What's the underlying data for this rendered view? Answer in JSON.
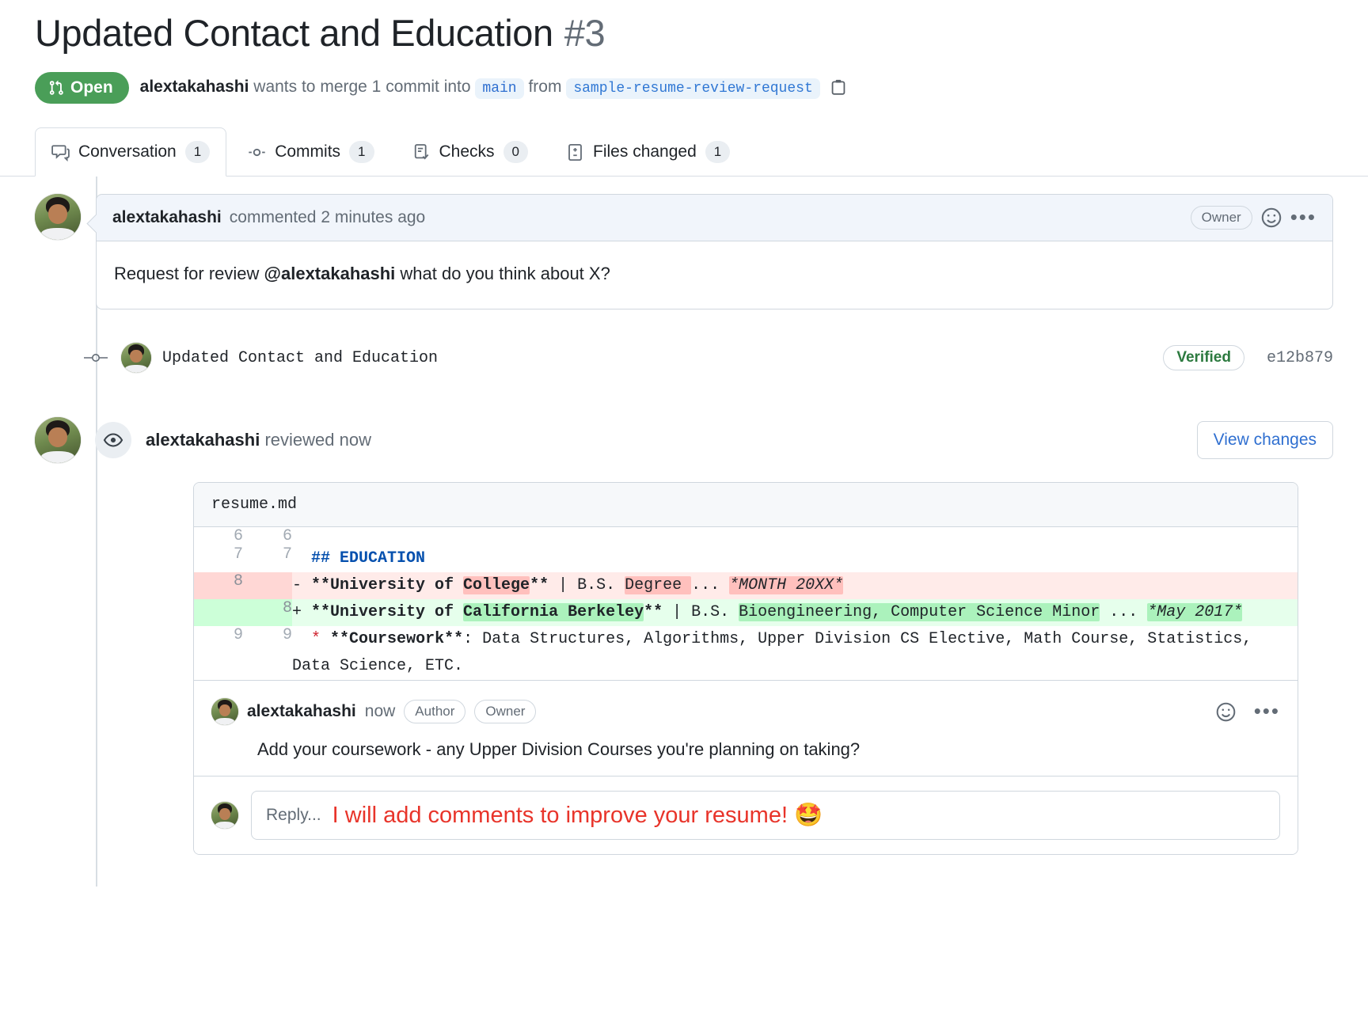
{
  "header": {
    "title": "Updated Contact and Education",
    "number": "#3",
    "state": "Open",
    "author": "alextakahashi",
    "merge_text_1": "wants to merge 1 commit into",
    "base_branch": "main",
    "from_word": "from",
    "head_branch": "sample-resume-review-request",
    "copy_icon": "copy-icon"
  },
  "tabs": [
    {
      "label": "Conversation",
      "count": "1",
      "icon": "comment-discussion-icon",
      "active": true
    },
    {
      "label": "Commits",
      "count": "1",
      "icon": "git-commit-icon",
      "active": false
    },
    {
      "label": "Checks",
      "count": "0",
      "icon": "checklist-icon",
      "active": false
    },
    {
      "label": "Files changed",
      "count": "1",
      "icon": "file-diff-icon",
      "active": false
    }
  ],
  "conversation": {
    "author": "alextakahashi",
    "when": "commented 2 minutes ago",
    "badge": "Owner",
    "reaction_icon": "smiley-icon",
    "menu_icon": "kebab-horizontal-icon",
    "body_prefix": "Request for review ",
    "body_mention": "@alextakahashi",
    "body_suffix": " what do you think about X?"
  },
  "commit": {
    "node_icon": "git-commit-node-icon",
    "message": "Updated Contact and Education",
    "verified": "Verified",
    "sha": "e12b879"
  },
  "review": {
    "icon": "eye-icon",
    "author": "alextakahashi",
    "action": "reviewed now",
    "view_changes": "View changes"
  },
  "diff": {
    "filename": "resume.md",
    "rows": [
      {
        "type": "ctx",
        "old": "6",
        "new": "6",
        "segments": [
          {
            "t": "",
            "c": ""
          }
        ]
      },
      {
        "type": "ctx",
        "old": "7",
        "new": "7",
        "segments": [
          {
            "t": "  ",
            "c": ""
          },
          {
            "t": "## EDUCATION",
            "c": "md-head"
          }
        ]
      },
      {
        "type": "del",
        "old": "8",
        "new": "",
        "segments": [
          {
            "t": "- ",
            "c": ""
          },
          {
            "t": "**University of ",
            "c": "bld"
          },
          {
            "t": "College",
            "c": "bld wd"
          },
          {
            "t": "**",
            "c": "bld"
          },
          {
            "t": " | B.S. ",
            "c": ""
          },
          {
            "t": "Degree ",
            "c": "wd"
          },
          {
            "t": "... ",
            "c": ""
          },
          {
            "t": "*MONTH 20XX*",
            "c": "ital wd"
          }
        ]
      },
      {
        "type": "add",
        "old": "",
        "new": "8",
        "segments": [
          {
            "t": "+ ",
            "c": ""
          },
          {
            "t": "**University of ",
            "c": "bld"
          },
          {
            "t": "California Berkeley",
            "c": "bld wa"
          },
          {
            "t": "**",
            "c": "bld"
          },
          {
            "t": " | B.S. ",
            "c": ""
          },
          {
            "t": "Bioengineering, Computer Science Minor",
            "c": "wa"
          },
          {
            "t": " ... ",
            "c": ""
          },
          {
            "t": "*May 2017*",
            "c": "ital wa"
          }
        ]
      },
      {
        "type": "ctx",
        "old": "9",
        "new": "9",
        "segments": [
          {
            "t": "  ",
            "c": ""
          },
          {
            "t": "*",
            "c": "bullet"
          },
          {
            "t": " ",
            "c": ""
          },
          {
            "t": "**Coursework**",
            "c": "bld"
          },
          {
            "t": ": Data Structures, Algorithms, Upper Division CS Elective, Math Course, Statistics, Data Science, ETC.",
            "c": ""
          }
        ]
      }
    ]
  },
  "inline_comment": {
    "author": "alextakahashi",
    "when": "now",
    "badge_author": "Author",
    "badge_owner": "Owner",
    "reaction_icon": "smiley-icon",
    "menu_icon": "kebab-horizontal-icon",
    "body": "Add your coursework - any Upper Division Courses you're planning on taking?"
  },
  "reply": {
    "placeholder": "Reply...",
    "annotation": "I will add comments to improve your resume!",
    "annotation_emoji": "🤩"
  },
  "colors": {
    "open_green": "#4a9e58",
    "link_blue": "#2f6fd0",
    "verified_green": "#2c7a3f",
    "annotation_red": "#e8342a",
    "add_bg": "#e6ffec",
    "del_bg": "#ffebe9"
  }
}
